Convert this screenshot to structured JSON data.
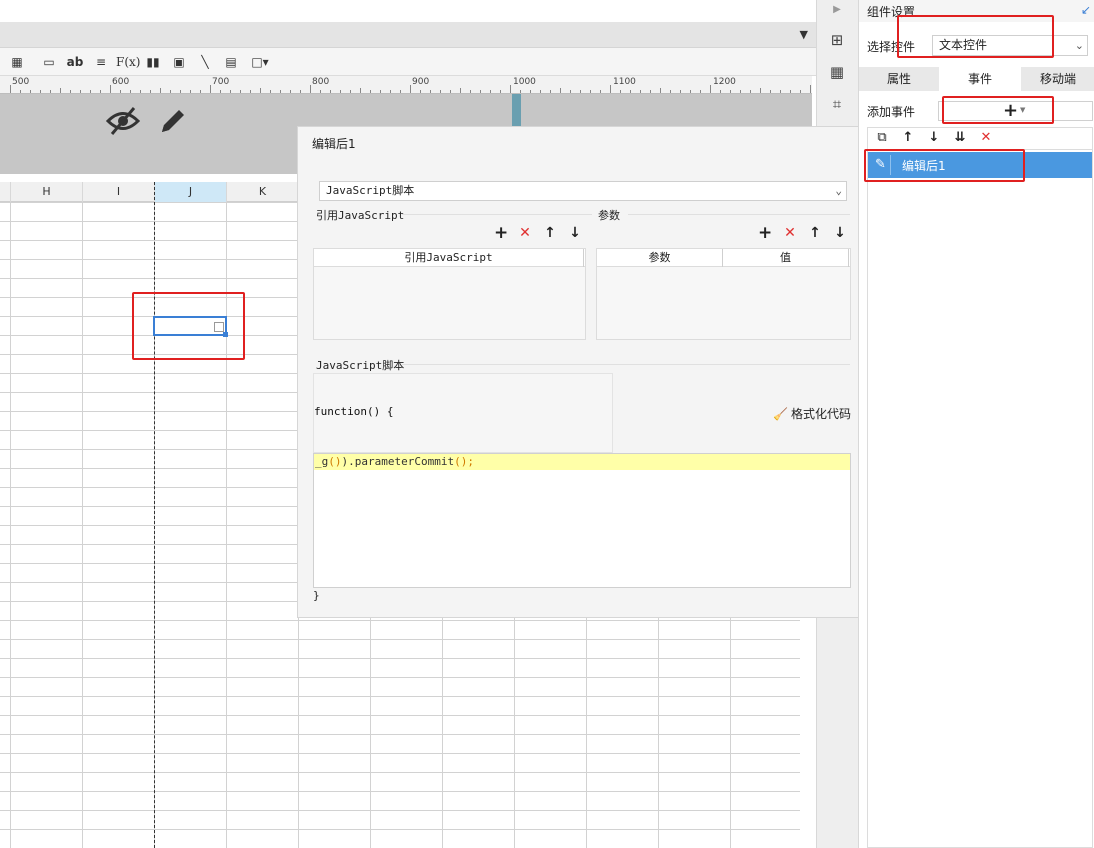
{
  "ruler": {
    "labels": [
      "500",
      "600",
      "700",
      "800",
      "900",
      "1000",
      "1100",
      "1200"
    ]
  },
  "toolbar": {
    "text_tool": "ab",
    "formula_tool": "F(x)"
  },
  "columns": [
    "H",
    "I",
    "J",
    "K"
  ],
  "dialog": {
    "title": "编辑后1",
    "type_select": "JavaScript脚本",
    "ref_js_section": "引用JavaScript",
    "params_section": "参数",
    "ref_js_header": "引用JavaScript",
    "param_header": "参数",
    "value_header": "值",
    "script_section": "JavaScript脚本",
    "function_sig": "function() {",
    "format_button": "格式化代码",
    "code_prefix": "_g",
    "code_paren_open": "(",
    "code_method": ").parameterCommit",
    "code_paren_close": "();",
    "close_brace": "}"
  },
  "right_panel": {
    "title": "组件设置",
    "select_label": "选择控件",
    "select_value": "文本控件",
    "tabs": [
      "属性",
      "事件",
      "移动端"
    ],
    "active_tab": "事件",
    "add_event_label": "添加事件",
    "event_item": "编辑后1"
  },
  "colors": {
    "accent": "#4a98e0",
    "delete": "#e03030",
    "annotation": "#e02020",
    "code_highlight": "#ffffa8"
  }
}
